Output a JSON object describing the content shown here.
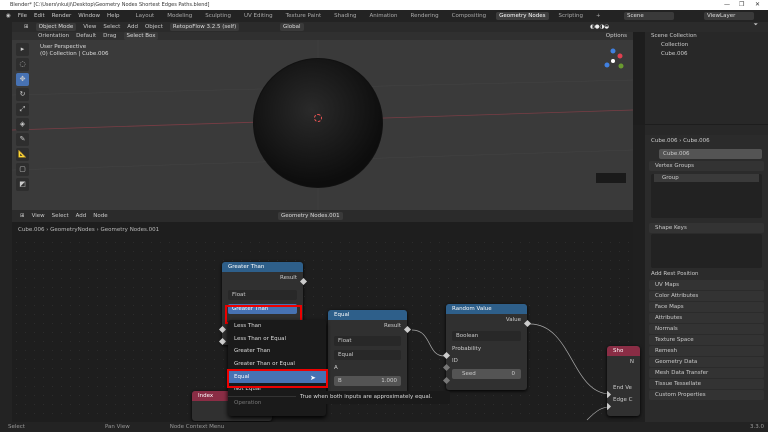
{
  "window": {
    "title": "Blender* [C:\\Users\\nkuiji\\Desktop\\Geometry Nodes Shortest Edges Paths.blend]",
    "controls": [
      "—",
      "❐",
      "✕"
    ]
  },
  "menubar": {
    "items": [
      "File",
      "Edit",
      "Render",
      "Window",
      "Help"
    ],
    "workspaces": [
      "Layout",
      "Modeling",
      "Sculpting",
      "UV Editing",
      "Texture Paint",
      "Shading",
      "Animation",
      "Rendering",
      "Compositing",
      "Geometry Nodes",
      "Scripting",
      "+"
    ],
    "active_workspace": "Geometry Nodes",
    "scene": "Scene",
    "view_layer": "ViewLayer"
  },
  "viewport": {
    "mode": "Object Mode",
    "menus": [
      "View",
      "Select",
      "Add",
      "Object"
    ],
    "addon": "RetopoFlow 3.2.5 (self)",
    "transform": "Global",
    "orientation_label": "Orientation",
    "orientation": "Default",
    "drag_label": "Drag",
    "drag": "Select Box",
    "options": "Options",
    "overlay_title": "User Perspective",
    "overlay_sub": "(0) Collection | Cube.006"
  },
  "outliner": {
    "root": "Scene Collection",
    "items": [
      "Collection",
      "Cube.006"
    ]
  },
  "properties": {
    "breadcrumb": [
      "Cube.006",
      "Cube.006"
    ],
    "mesh_name": "Cube.006",
    "vertex_groups": {
      "title": "Vertex Groups",
      "items": [
        "Group"
      ]
    },
    "shape_keys": {
      "title": "Shape Keys",
      "add_rest": "Add Rest Position"
    },
    "panels": [
      "UV Maps",
      "Color Attributes",
      "Face Maps",
      "Attributes",
      "Normals",
      "Texture Space",
      "Remesh",
      "Geometry Data",
      "Mesh Data Transfer",
      "Tissue Tessellate",
      "Custom Properties"
    ],
    "version": "3.3.0"
  },
  "node_editor": {
    "menus": [
      "View",
      "Select",
      "Add",
      "Node"
    ],
    "tree": "Geometry Nodes.001",
    "breadcrumb": [
      "Cube.006",
      "GeometryNodes",
      "Geometry Nodes.001"
    ],
    "greater_than": {
      "title": "Greater Than",
      "output": "Result",
      "type": "Float",
      "operation": "Greater Than"
    },
    "equal": {
      "title": "Equal",
      "output": "Result",
      "type": "Float",
      "operation": "Equal",
      "input_a": "A",
      "input_b": "B",
      "b_value": "1.000"
    },
    "random": {
      "title": "Random Value",
      "output": "Value",
      "type": "Boolean",
      "inputs": [
        "Probability",
        "ID"
      ],
      "seed_label": "Seed",
      "seed": "0"
    },
    "shortest": {
      "title": "Sho",
      "output": "N",
      "inputs": [
        "End Ve",
        "Edge C"
      ]
    },
    "index": {
      "title": "Index"
    },
    "menu": {
      "items": [
        "Less Than",
        "Less Than or Equal",
        "Greater Than",
        "Greater Than or Equal",
        "Equal",
        "Not Equal"
      ],
      "highlighted": "Equal",
      "footer": "Operation"
    },
    "tooltip": "True when both inputs are approximately equal."
  },
  "statusbar": {
    "items": [
      "Select",
      "Pan View",
      "Node Context Menu"
    ]
  },
  "colors": {
    "accent": "#4772b3",
    "highlight_box": "#e00000",
    "math_header": "#2e5f8a",
    "geometry_header": "#8a2d45"
  }
}
